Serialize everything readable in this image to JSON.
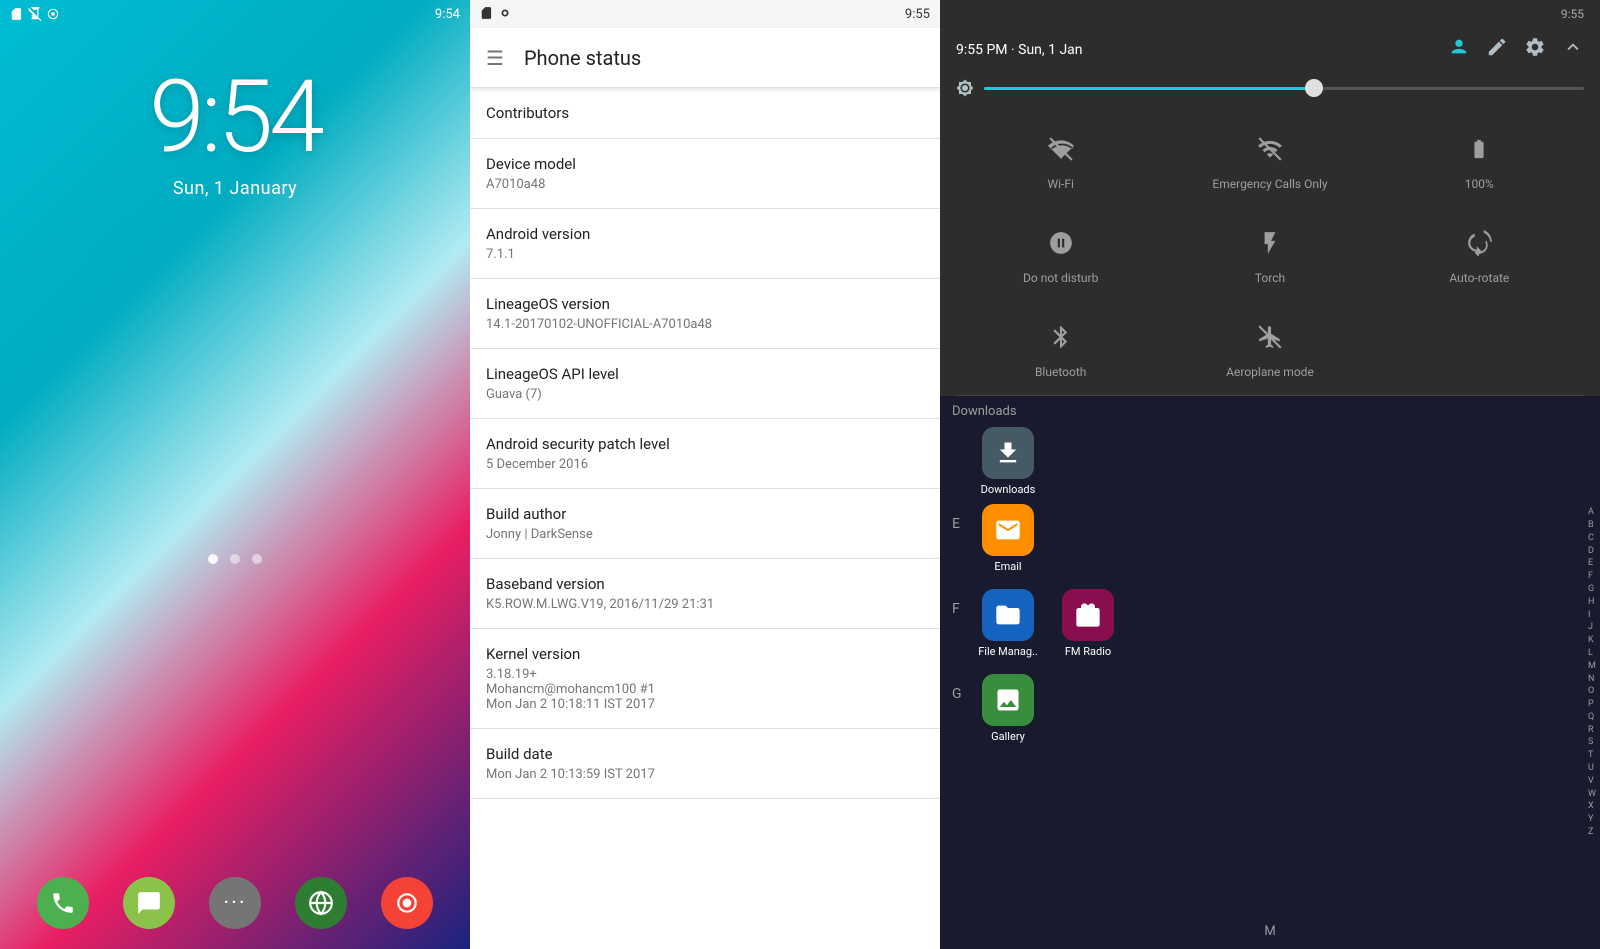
{
  "lockScreen": {
    "time": "9:54",
    "date": "Sun, 1 January",
    "statusBar": {
      "time": "9:54"
    },
    "dock": [
      {
        "name": "Phone",
        "icon": "📞",
        "color": "#4CAF50"
      },
      {
        "name": "Messages",
        "icon": "💬",
        "color": "#8BC34A"
      },
      {
        "name": "Apps",
        "icon": "⋯",
        "color": "#9E9E9E"
      },
      {
        "name": "Browser",
        "icon": "◉",
        "color": "#2E7D32"
      },
      {
        "name": "Record",
        "icon": "⏺",
        "color": "#F44336"
      }
    ]
  },
  "phoneStatus": {
    "statusBar": {
      "time": "9:55"
    },
    "title": "Phone status",
    "items": [
      {
        "label": "Contributors",
        "value": ""
      },
      {
        "label": "Device model",
        "value": "A7010a48"
      },
      {
        "label": "Android version",
        "value": "7.1.1"
      },
      {
        "label": "LineageOS version",
        "value": "14.1-20170102-UNOFFICIAL-A7010a48"
      },
      {
        "label": "LineageOS API level",
        "value": "Guava (7)"
      },
      {
        "label": "Android security patch level",
        "value": "5 December 2016"
      },
      {
        "label": "Build author",
        "value": "Jonny | DarkSense"
      },
      {
        "label": "Baseband version",
        "value": "K5.ROW.M.LWG.V19, 2016/11/29 21:31"
      },
      {
        "label": "Kernel version",
        "value": "3.18.19+\nMohancm@mohancm100 #1\nMon Jan 2 10:18:11 IST 2017"
      },
      {
        "label": "Build date",
        "value": "Mon Jan 2 10:13:59 IST 2017"
      }
    ]
  },
  "quickSettings": {
    "statusBar": {
      "datetime": "9:55 PM · Sun, 1 Jan"
    },
    "headerIcons": [
      "person",
      "edit",
      "settings",
      "expand"
    ],
    "brightness": 55,
    "tiles": [
      {
        "label": "Wi-Fi",
        "icon": "wifi_off",
        "active": false
      },
      {
        "label": "Emergency Calls Only",
        "icon": "signal_off",
        "active": false
      },
      {
        "label": "100%",
        "icon": "battery_full",
        "active": false
      },
      {
        "label": "Do not disturb",
        "icon": "dnd",
        "active": false
      },
      {
        "label": "Torch",
        "icon": "torch",
        "active": false
      },
      {
        "label": "Auto-rotate",
        "icon": "rotate",
        "active": false
      },
      {
        "label": "Bluetooth",
        "icon": "bluetooth",
        "active": false
      },
      {
        "label": "Aeroplane mode",
        "icon": "airplane",
        "active": false
      }
    ],
    "appDrawer": {
      "sections": [
        {
          "letter": "",
          "apps": [
            {
              "name": "Downloads",
              "color": "#607d8b"
            }
          ]
        },
        {
          "letter": "E",
          "apps": [
            {
              "name": "Email",
              "color": "#FF8F00"
            }
          ]
        },
        {
          "letter": "F",
          "apps": [
            {
              "name": "File Manag..",
              "color": "#1565C0"
            },
            {
              "name": "FM Radio",
              "color": "#880E4F"
            }
          ]
        },
        {
          "letter": "G",
          "apps": [
            {
              "name": "Gallery",
              "color": "#388E3C"
            }
          ]
        }
      ],
      "alphabet": [
        "A",
        "B",
        "C",
        "D",
        "E",
        "F",
        "G",
        "H",
        "I",
        "J",
        "K",
        "L",
        "M",
        "N",
        "O",
        "P",
        "Q",
        "R",
        "S",
        "T",
        "U",
        "V",
        "W",
        "X",
        "Y",
        "Z"
      ],
      "currentLetter": "M"
    }
  }
}
